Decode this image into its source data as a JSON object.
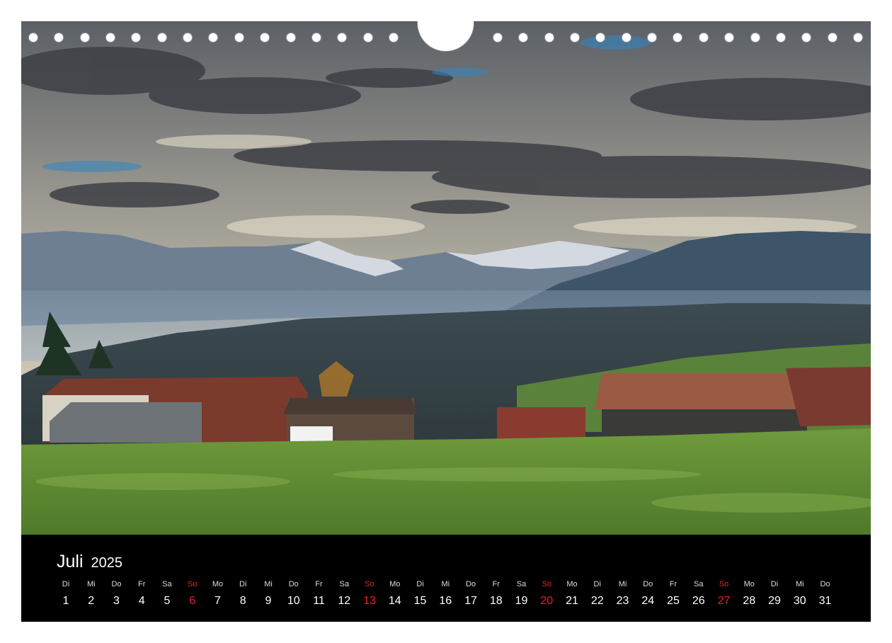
{
  "month": {
    "name": "Juli",
    "year": "2025"
  },
  "days": [
    {
      "wd": "Di",
      "num": "1"
    },
    {
      "wd": "Mi",
      "num": "2"
    },
    {
      "wd": "Do",
      "num": "3"
    },
    {
      "wd": "Fr",
      "num": "4"
    },
    {
      "wd": "Sa",
      "num": "5"
    },
    {
      "wd": "So",
      "num": "6",
      "sunday": true
    },
    {
      "wd": "Mo",
      "num": "7"
    },
    {
      "wd": "Di",
      "num": "8"
    },
    {
      "wd": "Mi",
      "num": "9"
    },
    {
      "wd": "Do",
      "num": "10"
    },
    {
      "wd": "Fr",
      "num": "11"
    },
    {
      "wd": "Sa",
      "num": "12"
    },
    {
      "wd": "So",
      "num": "13",
      "sunday": true
    },
    {
      "wd": "Mo",
      "num": "14"
    },
    {
      "wd": "Di",
      "num": "15"
    },
    {
      "wd": "Mi",
      "num": "16"
    },
    {
      "wd": "Do",
      "num": "17"
    },
    {
      "wd": "Fr",
      "num": "18"
    },
    {
      "wd": "Sa",
      "num": "19"
    },
    {
      "wd": "So",
      "num": "20",
      "sunday": true
    },
    {
      "wd": "Mo",
      "num": "21"
    },
    {
      "wd": "Di",
      "num": "22"
    },
    {
      "wd": "Mi",
      "num": "23"
    },
    {
      "wd": "Do",
      "num": "24"
    },
    {
      "wd": "Fr",
      "num": "25"
    },
    {
      "wd": "Sa",
      "num": "26"
    },
    {
      "wd": "So",
      "num": "27",
      "sunday": true
    },
    {
      "wd": "Mo",
      "num": "28"
    },
    {
      "wd": "Di",
      "num": "29"
    },
    {
      "wd": "Mi",
      "num": "30"
    },
    {
      "wd": "Do",
      "num": "31"
    }
  ],
  "colors": {
    "sunday": "#e3242b",
    "background": "#000000",
    "text": "#ffffff"
  }
}
